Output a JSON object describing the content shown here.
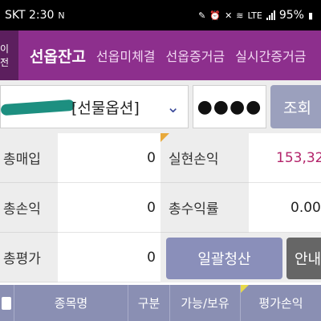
{
  "status_bar": {
    "carrier_time": "SKT 2:30",
    "battery": "95%",
    "icons": [
      "notification-icon",
      "edit-icon",
      "alarm-icon",
      "mute-icon",
      "wifi-icon",
      "lte-icon",
      "signal-icon",
      "battery-icon"
    ]
  },
  "tabs": {
    "prev_label": "이전",
    "items": [
      {
        "label": "선옵잔고",
        "active": true
      },
      {
        "label": "선옵미체결",
        "active": false
      },
      {
        "label": "선옵증거금",
        "active": false
      },
      {
        "label": "실시간증거금",
        "active": false
      }
    ]
  },
  "account": {
    "type_text": "[선물옵션]",
    "password_value": "●●●●",
    "query_button": "조회"
  },
  "summary": {
    "total_purchase_label": "총매입",
    "total_purchase_value": "0",
    "realized_pnl_label": "실현손익",
    "realized_pnl_value": "153,32",
    "total_pnl_label": "총손익",
    "total_pnl_value": "0",
    "total_return_label": "총수익률",
    "total_return_value": "0.00",
    "total_valuation_label": "총평가",
    "total_valuation_value": "0",
    "liquidate_button": "일괄청산",
    "guide_button": "안내"
  },
  "table": {
    "columns": [
      "종목명",
      "구분",
      "가능/보유",
      "평가손익"
    ]
  },
  "colors": {
    "tab_bar": "#8d2f8d",
    "accent_red": "#b3236a",
    "button_blue": "#8a8fba",
    "header_bg": "#8a8fb3"
  }
}
